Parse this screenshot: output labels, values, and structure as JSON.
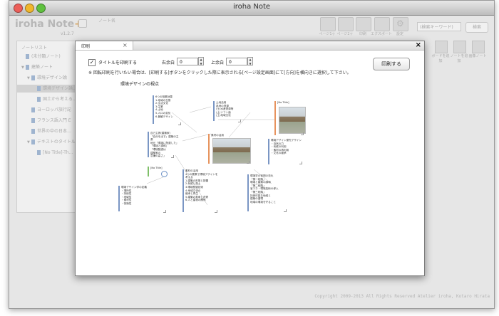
{
  "window": {
    "title": "iroha Note"
  },
  "app": {
    "logo": "iroha Note",
    "logo_plus": "+",
    "version": "v1.2.7",
    "note_title_label": "ノート名"
  },
  "toolbar": {
    "buttons": [
      "ページ1ヶ",
      "ページ2ヶ",
      "印刷",
      "エクスポート",
      "設定"
    ],
    "search_placeholder": "(検索キーワード)",
    "search_button": "検索"
  },
  "right_tools": [
    "ボードを追加",
    "ノートを追加",
    "画像ノート"
  ],
  "sidebar": {
    "header": "ノートリスト",
    "items": [
      {
        "label": "(未分類ノート)",
        "indent": 0,
        "arrow": ""
      },
      {
        "label": "建築ノート",
        "indent": 0,
        "arrow": "▼"
      },
      {
        "label": "環境デザイン論",
        "indent": 1,
        "arrow": "▼"
      },
      {
        "label": "環境デザイン論…",
        "indent": 2,
        "arrow": "",
        "selected": true
      },
      {
        "label": "国土から考える…",
        "indent": 2,
        "arrow": ""
      },
      {
        "label": "ヨーロッパ旅行記",
        "indent": 1,
        "arrow": ""
      },
      {
        "label": "フランス語入門 E",
        "indent": 1,
        "arrow": ""
      },
      {
        "label": "世界の中の日本…",
        "indent": 1,
        "arrow": ""
      },
      {
        "label": "テキストのタイトル",
        "indent": 1,
        "arrow": "▼"
      },
      {
        "label": "[No Title]-Th…",
        "indent": 2,
        "arrow": ""
      }
    ]
  },
  "dialog": {
    "tab_label": "印刷",
    "print_title_label": "タイトルを印刷する",
    "print_title_checked": "✓",
    "right_margin_label": "右余白",
    "right_margin_value": "0",
    "top_margin_label": "上余白",
    "top_margin_value": "0",
    "note": "※ 回転印刷を行いたい場合は、[印刷する]ボタンをクリックした際に表示される[ページ設定画面]にて[方向]を横向きに選択して下さい。",
    "print_button": "印刷する",
    "close": "×",
    "tab_close": "×"
  },
  "preview": {
    "title": "環境デザインの視点",
    "cards": {
      "c1": "6つの相乗効果\n1.地域の生態\n2.生活文化\n3.生業\n4.土地\n5.人口の変化\n6.景観デザイン",
      "c2": "土地活用\n各地の資源\n(土)水産資源等\n(土)ソフト面\n(土)地域文化",
      "c3": "[No Title]",
      "c4": "自己主張(建築家)\n「自分を出す」建築の主張\n地元「環境に配慮した」\n「環境と調和」\n「環境配慮は\n建築家の\n意識の高さ」",
      "c5": "素材の活用",
      "c6": "環境デザイン優先デザイン\n・自然の力\n・気候の利用\n・素材の再利用\n・文化の継承",
      "c7": "[No Title]",
      "c8": "素材の活用\n4つの要素で環境デザインを\n考える\n1.建築の形態と配置\n2.気候と風土\n3.環境配慮技術\n4.地域文化の\n継承と再生\n5.建築の寿命と改修\n6.人と建物の関係",
      "c9": "環境学の役割の流れ\n「第一段階」\n環境と建築の調和\n「第二段階」\n省エネ・環境技術の導入\n「第三段階」\n持続可能な地域と\n建築の循環\n地域の環境を守ること",
      "c10": "環境デザイン学の定義\n・場所性\n・持続性\n・地域性\n・素材性\n・快適性"
    }
  },
  "footer": {
    "copyright": "Copyright 2009-2013 All Rights Reserved Atelier iroha, Kotaro Hirata"
  }
}
